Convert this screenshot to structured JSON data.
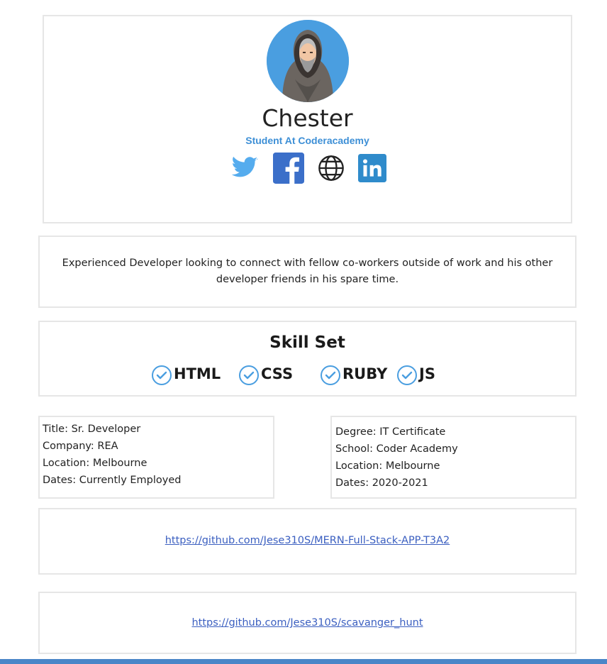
{
  "profile": {
    "name": "Chester",
    "role": "Student At Coderacademy",
    "avatar_icon": "hooded-user-avatar",
    "socials": [
      {
        "icon": "twitter-icon",
        "color": "#55acee"
      },
      {
        "icon": "facebook-icon",
        "color": "#3b6fc9"
      },
      {
        "icon": "globe-icon",
        "color": "#222222"
      },
      {
        "icon": "linkedin-icon",
        "color": "#2f8bcb"
      }
    ]
  },
  "bio": {
    "text": "Experienced Developer looking to connect with fellow co-workers outside of work and his other developer friends in his spare time."
  },
  "skills": {
    "title": "Skill Set",
    "items": [
      "HTML",
      "CSS",
      "RUBY",
      "JS"
    ],
    "check_color": "#4a9ee0"
  },
  "experience": {
    "title": "Title: Sr. Developer",
    "company": "Company: REA",
    "location": "Location: Melbourne",
    "dates": "Dates: Currently Employed"
  },
  "education": {
    "degree": "Degree: IT Certificate",
    "school": "School: Coder Academy",
    "location": "Location: Melbourne",
    "dates": "Dates: 2020-2021"
  },
  "links": [
    "https://github.com/Jese310S/MERN-Full-Stack-APP-T3A2",
    "https://github.com/Jese310S/scavanger_hunt"
  ],
  "colors": {
    "accent": "#4a9ee0",
    "link": "#3b5fc0",
    "bottom_bar": "#4a86c8"
  }
}
